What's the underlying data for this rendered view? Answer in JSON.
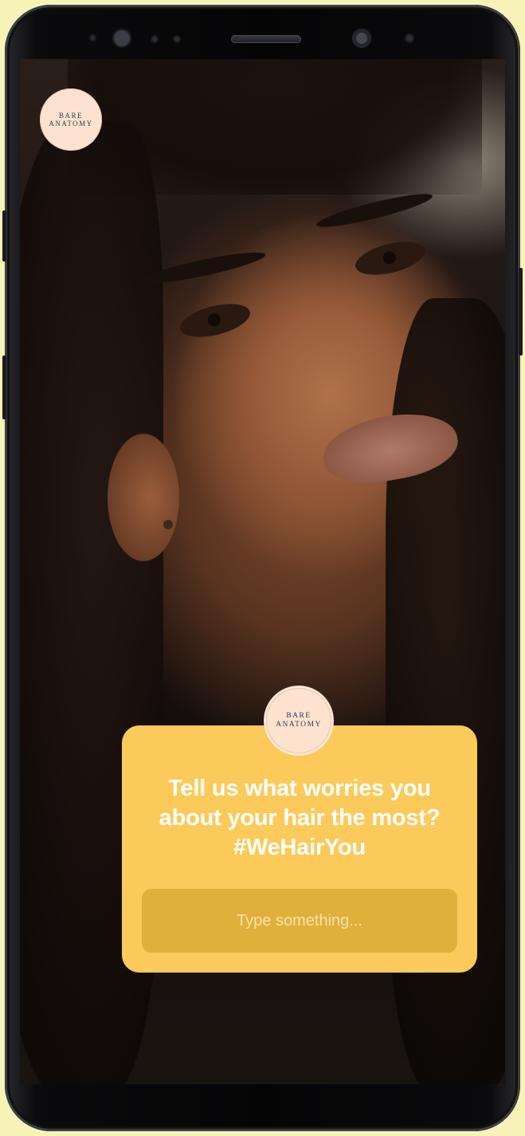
{
  "brand": {
    "logo_line1": "BARE",
    "logo_line2": "ANATOMY",
    "color": "#2e3b55",
    "badge_bg": "#fde3cf"
  },
  "question_card": {
    "line1": "Tell us what worries you",
    "line2": "about your hair the most?",
    "line3": "#WeHairYou",
    "input_placeholder": "Type something...",
    "card_color": "#fcca5a",
    "input_color": "#e1b03b"
  },
  "icons": [
    "front-camera-icon",
    "proximity-sensor-icon",
    "earpiece-speaker-icon",
    "iris-scanner-icon"
  ]
}
